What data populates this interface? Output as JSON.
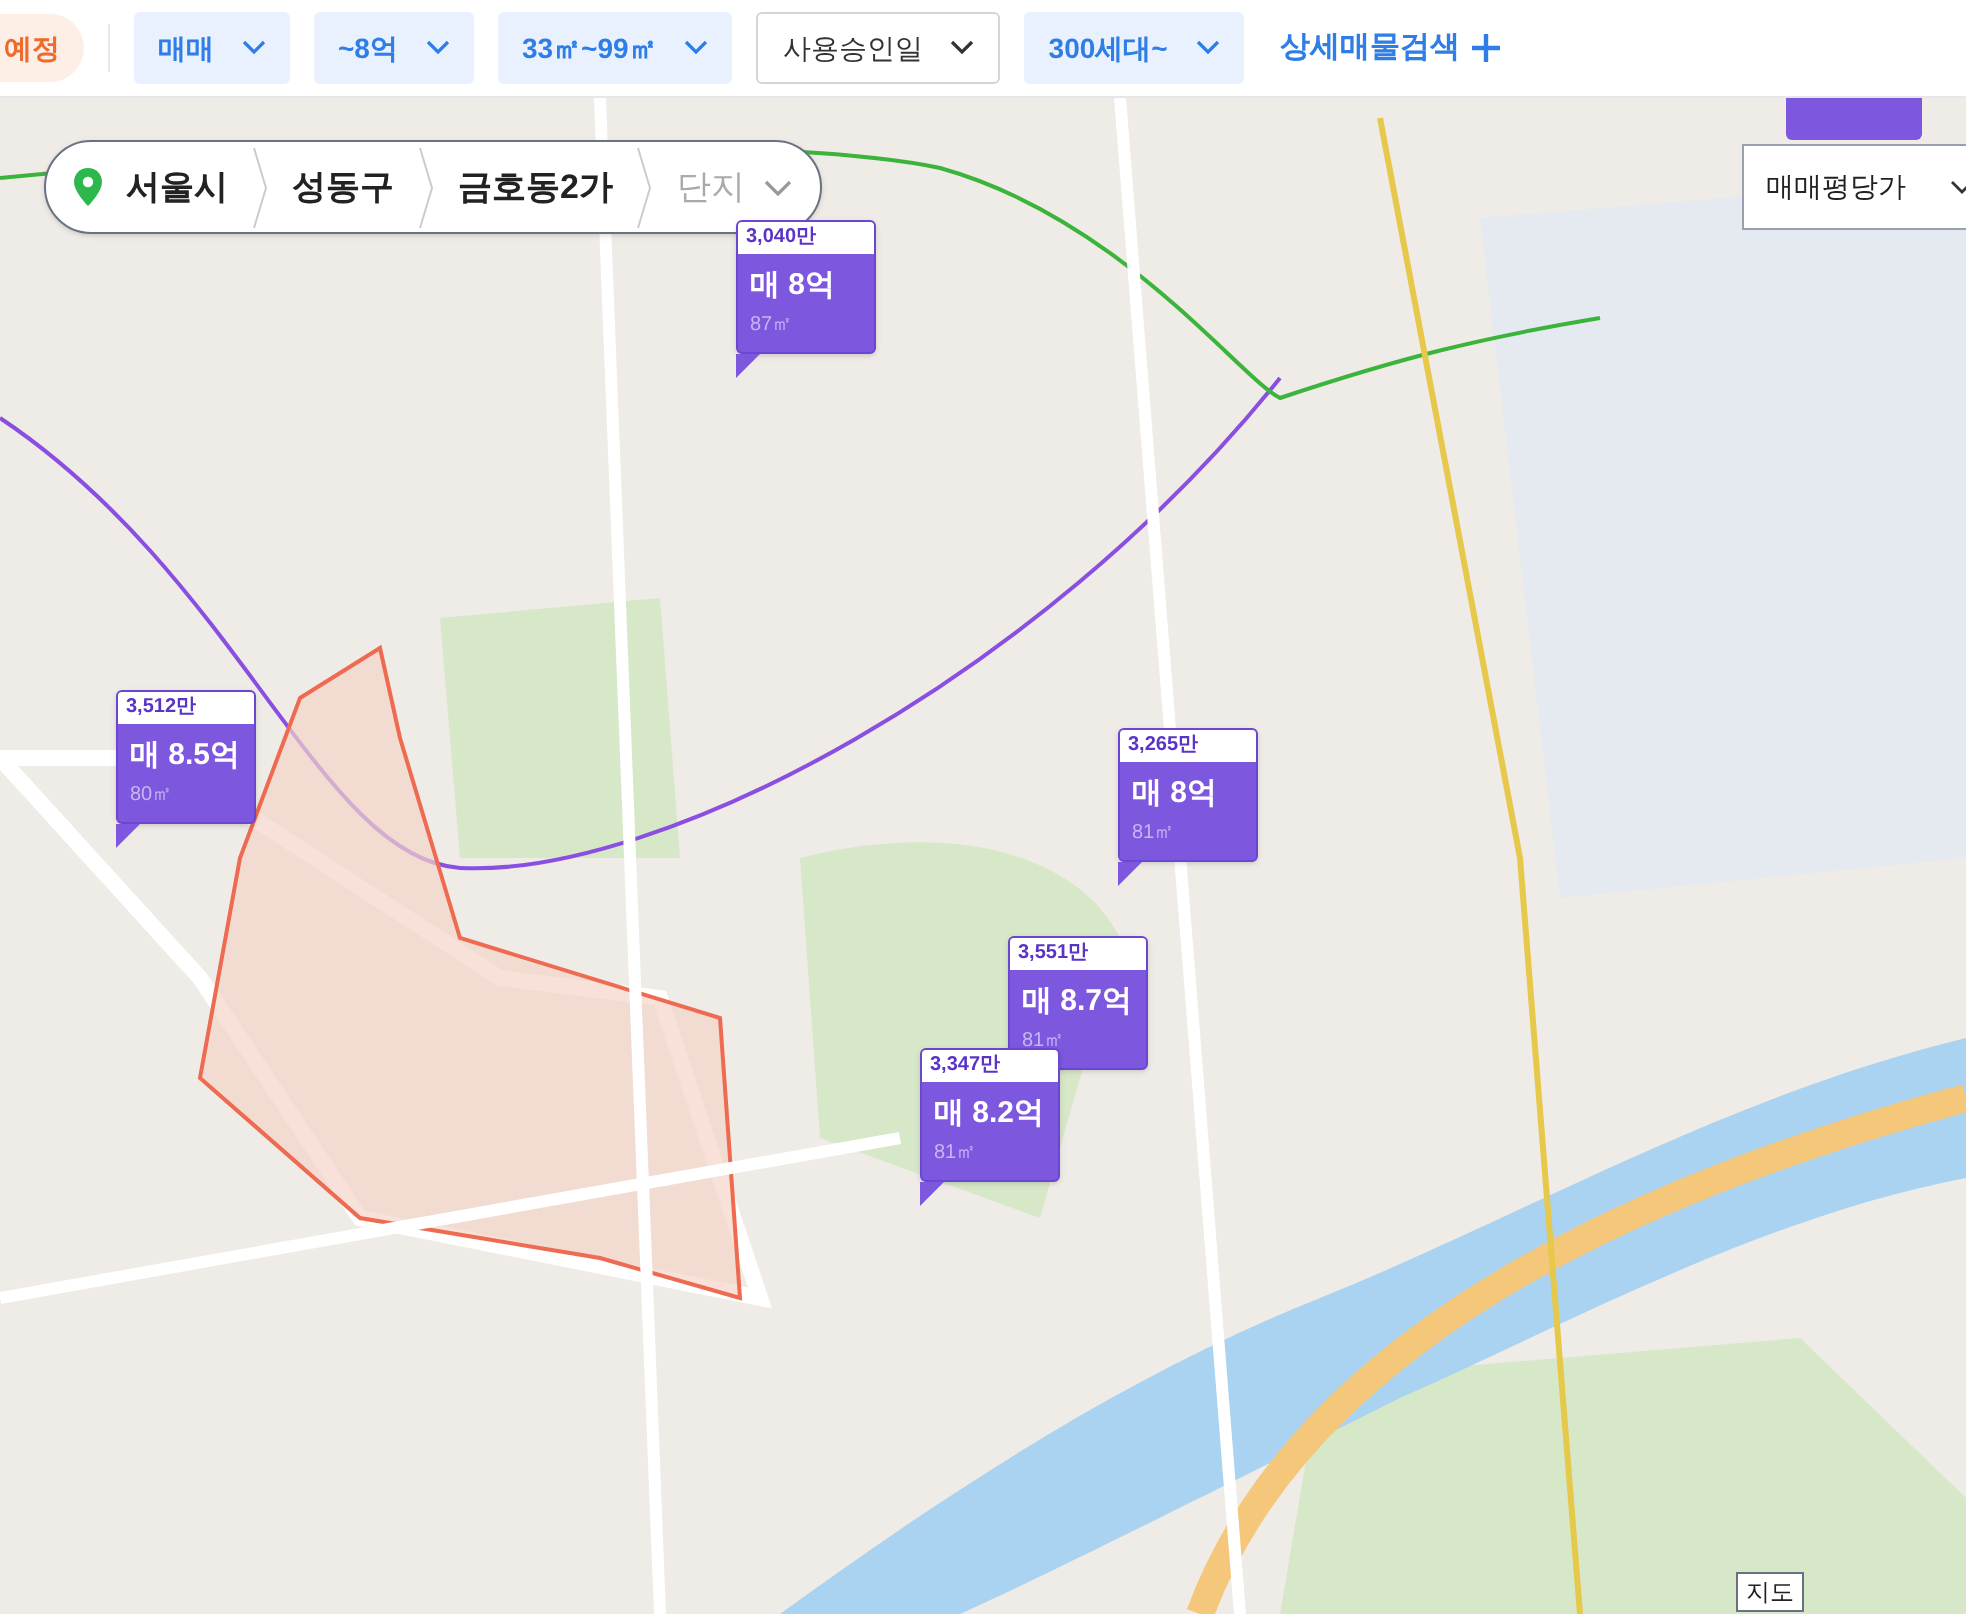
{
  "filter_bar": {
    "leading_chip": {
      "label": "예정"
    },
    "filters": [
      {
        "label": "매매",
        "selected": true
      },
      {
        "label": "~8억",
        "selected": true
      },
      {
        "label": "33㎡~99㎡",
        "selected": true
      },
      {
        "label": "사용승인일",
        "selected": false
      },
      {
        "label": "300세대~",
        "selected": true
      }
    ],
    "detail_search": {
      "label": "상세매물검색"
    }
  },
  "map": {
    "kind": "picture",
    "breadcrumb": [
      "서울시",
      "성동구",
      "금호동2가"
    ],
    "breadcrumb_placeholder": "단지",
    "price_type": "매매평당가",
    "price_markers": [
      {
        "unit_price": "3,040만",
        "price": "매 8억",
        "area": "87㎡"
      },
      {
        "unit_price": "3,512만",
        "price": "매 8.5억",
        "area": "80㎡"
      },
      {
        "unit_price": "3,265만",
        "price": "매 8억",
        "area": "81㎡"
      },
      {
        "unit_price": "3,551만",
        "price": "매 8.7억",
        "area": "81㎡"
      },
      {
        "unit_price": "3,347만",
        "price": "매 8.2억",
        "area": "81㎡"
      }
    ],
    "legend_button": "지도"
  }
}
